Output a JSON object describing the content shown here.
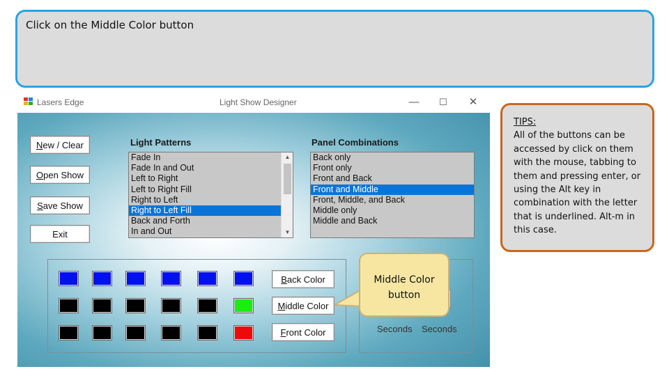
{
  "instruction": "Click on the Middle Color button",
  "window": {
    "app_name": "Lasers Edge",
    "title": "Light Show Designer",
    "minimize": "—",
    "maximize": "☐",
    "close": "✕"
  },
  "buttons": {
    "new_clear": {
      "pre": "",
      "key": "N",
      "post": "ew / Clear"
    },
    "open_show": {
      "pre": "",
      "key": "O",
      "post": "pen Show"
    },
    "save_show": {
      "pre": "",
      "key": "S",
      "post": "ave Show"
    },
    "exit": {
      "pre": "",
      "key": "",
      "post": "Exit"
    },
    "back_color": {
      "pre": "",
      "key": "B",
      "post": "ack Color"
    },
    "middle_color": {
      "pre": "",
      "key": "M",
      "post": "iddle Color"
    },
    "front_color": {
      "pre": "",
      "key": "F",
      "post": "ront Color"
    }
  },
  "light_patterns": {
    "label": "Light Patterns",
    "items": [
      "Fade In",
      "Fade In and Out",
      "Left to Right",
      "Left to Right Fill",
      "Right to Left",
      "Right to Left Fill",
      "Back and Forth",
      "In and Out"
    ],
    "selected_index": 5
  },
  "panel_combinations": {
    "label": "Panel Combinations",
    "items": [
      "Back only",
      "Front only",
      "Front and Back",
      "Front and Middle",
      "Front, Middle, and Back",
      "Middle only",
      "Middle and Back"
    ],
    "selected_index": 3
  },
  "colors": {
    "blue": "#0010ee",
    "black": "#000000",
    "green": "#1aee10",
    "red": "#ee0a0a",
    "selection": "#0a74d8"
  },
  "panel_grid": [
    [
      "blue",
      "blue",
      "blue",
      "blue",
      "blue",
      "blue"
    ],
    [
      "black",
      "black",
      "black",
      "black",
      "black",
      "green"
    ],
    [
      "black",
      "black",
      "black",
      "black",
      "black",
      "red"
    ]
  ],
  "timing": {
    "seconds_1": "Seconds",
    "seconds_2": "Seconds"
  },
  "callout": {
    "line1": "Middle Color",
    "line2": "button"
  },
  "tips": {
    "heading": "TIPS:",
    "body": "All of the buttons can be accessed by click on them with the mouse, tabbing to them and pressing enter, or using the Alt key in combination with the letter that is underlined.  Alt-m in this case."
  }
}
